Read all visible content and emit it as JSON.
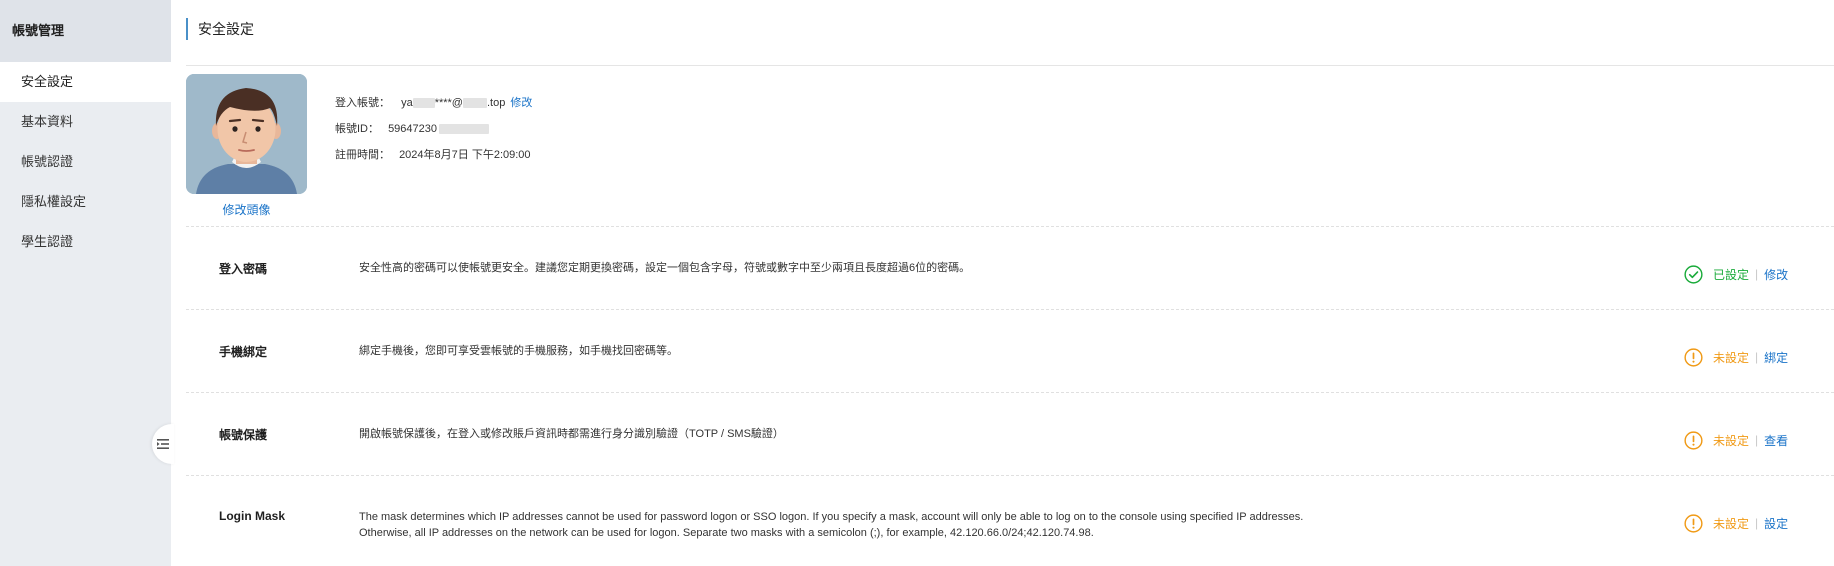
{
  "sidebar": {
    "title": "帳號管理",
    "items": [
      {
        "label": "安全設定",
        "active": true
      },
      {
        "label": "基本資料"
      },
      {
        "label": "帳號認證"
      },
      {
        "label": "隱私權設定"
      },
      {
        "label": "學生認證"
      }
    ]
  },
  "header": {
    "title": "安全設定"
  },
  "profile": {
    "change_avatar": "修改頭像",
    "login_label": "登入帳號：",
    "login_prefix": "ya",
    "login_mid": "****@",
    "login_suffix": ".top",
    "login_edit": "修改",
    "id_label": "帳號ID：",
    "id_value": "59647230",
    "reg_label": "註冊時間：",
    "reg_value": "2024年8月7日 下午2:09:00"
  },
  "settings": [
    {
      "name": "登入密碼",
      "desc": "安全性高的密碼可以使帳號更安全。建議您定期更換密碼，設定一個包含字母，符號或數字中至少兩項且長度超過6位的密碼。",
      "status": "已設定",
      "action": "修改",
      "state": "ok"
    },
    {
      "name": "手機綁定",
      "desc": "綁定手機後，您即可享受雲帳號的手機服務，如手機找回密碼等。",
      "status": "未設定",
      "action": "綁定",
      "state": "warn"
    },
    {
      "name": "帳號保護",
      "desc": "開啟帳號保護後，在登入或修改賬戶資訊時都需進行身分識別驗證（TOTP / SMS驗證）",
      "status": "未設定",
      "action": "查看",
      "state": "warn"
    },
    {
      "name": "Login Mask",
      "desc": "The mask determines which IP addresses cannot be used for password logon or SSO logon. If you specify a mask, account will only be able to log on to the console using specified IP addresses. Otherwise, all IP addresses on the network can be used for logon. Separate two masks with a semicolon (;), for example, 42.120.66.0/24;42.120.74.98.",
      "status": "未設定",
      "action": "設定",
      "state": "warn"
    }
  ],
  "colors": {
    "accent": "#1a73c8",
    "ok": "#1aab3a",
    "warn": "#f09a16",
    "sidebar_bg": "#eaedf1"
  },
  "icons": {
    "ok": "check-circle-icon",
    "warn": "warning-circle-icon",
    "collapse": "menu-collapse-icon"
  }
}
